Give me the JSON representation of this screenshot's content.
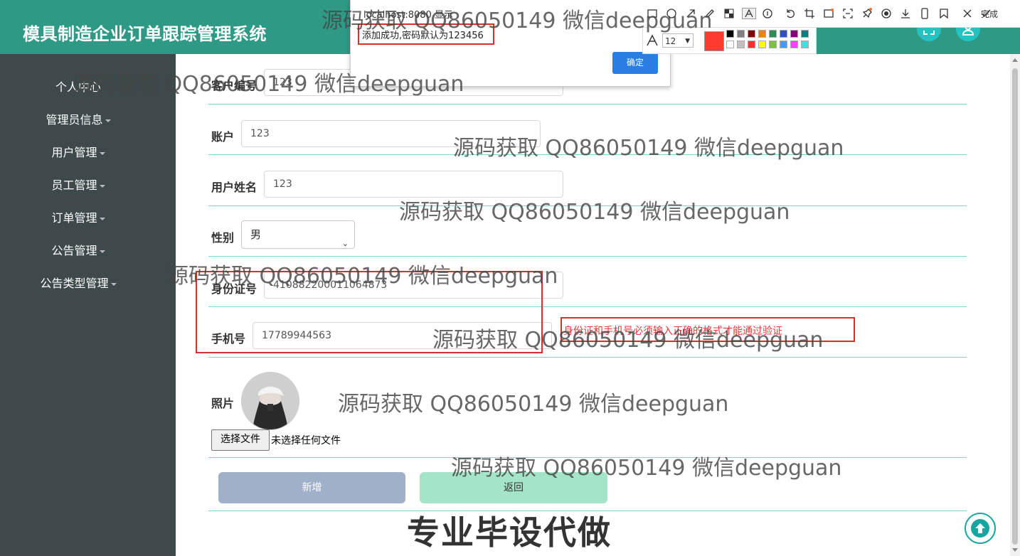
{
  "app": {
    "title": "模具制造企业订单跟踪管理系统"
  },
  "sidebar": {
    "items": [
      {
        "label": "个人中心",
        "has_caret": false
      },
      {
        "label": "管理员信息",
        "has_caret": true
      },
      {
        "label": "用户管理",
        "has_caret": true
      },
      {
        "label": "员工管理",
        "has_caret": true
      },
      {
        "label": "订单管理",
        "has_caret": true
      },
      {
        "label": "公告管理",
        "has_caret": true
      },
      {
        "label": "公告类型管理",
        "has_caret": true
      }
    ]
  },
  "form": {
    "customer_no": {
      "label": "客户编号",
      "value": "123"
    },
    "account": {
      "label": "账户",
      "value": "123"
    },
    "user_name": {
      "label": "用户姓名",
      "value": "123"
    },
    "gender": {
      "label": "性别",
      "value": "男"
    },
    "id_card": {
      "label": "身份证号",
      "value": "410882200011064873"
    },
    "phone": {
      "label": "手机号",
      "value": "17789944563"
    },
    "photo": {
      "label": "照片",
      "file_button": "选择文件",
      "file_status": "未选择任何文件"
    },
    "submit_label": "新增",
    "back_label": "返回"
  },
  "validation_hint": "身份证和手机号必须输入正确的格式才能通过验证",
  "dialog": {
    "title": "localhost:8080 显示",
    "message": "添加成功,密码默认为123456",
    "ok_label": "确定"
  },
  "annotation_toolbar": {
    "done_label": "完成",
    "font_size": "12",
    "current_color": "#ff3b30",
    "palette": [
      "#000000",
      "#808080",
      "#800000",
      "#f08000",
      "#2e8b57",
      "#3050c0",
      "#800080",
      "#008080",
      "#ffffff",
      "#c0c0c0",
      "#ff3030",
      "#ffff00",
      "#80c040",
      "#40a0ff",
      "#ff40ff",
      "#40e0e0"
    ]
  },
  "watermarks": {
    "repeat_text": "源码获取 QQ86050149 微信deepguan",
    "footer_text": "专业毕设代做"
  },
  "colors": {
    "header": "#2e9a86",
    "sidebar": "#3e494b",
    "accent_line": "#7fd3c6"
  }
}
